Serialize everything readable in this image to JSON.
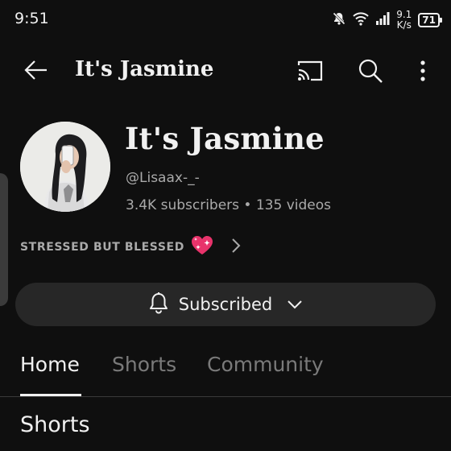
{
  "status_bar": {
    "time": "9:51",
    "net_speed_value": "9.1",
    "net_speed_unit": "K/s",
    "battery": "71",
    "icons": [
      "mute-icon",
      "wifi-icon",
      "signal-icon"
    ]
  },
  "app_bar": {
    "title": "It's Jasmine",
    "icons": [
      "back-arrow-icon",
      "cast-icon",
      "search-icon",
      "more-vertical-icon"
    ]
  },
  "channel": {
    "name": "It's Jasmine",
    "handle": "@Lisaax-_-",
    "stats": "3.4K subscribers • 135 videos",
    "description": "STRESSED BUT BLESSED",
    "description_emoji": "sparkling-heart-icon"
  },
  "subscribe_button": {
    "label": "Subscribed",
    "icons": [
      "bell-icon",
      "chevron-down-icon"
    ]
  },
  "tabs": [
    {
      "label": "Home",
      "active": true
    },
    {
      "label": "Shorts",
      "active": false
    },
    {
      "label": "Community",
      "active": false
    }
  ],
  "section": {
    "title": "Shorts"
  },
  "colors": {
    "background": "#0f0f0f",
    "text_primary": "#f1f1f1",
    "text_secondary": "#aaaaaa",
    "button_bg": "#272727",
    "emoji_heart": "#e8336b"
  }
}
